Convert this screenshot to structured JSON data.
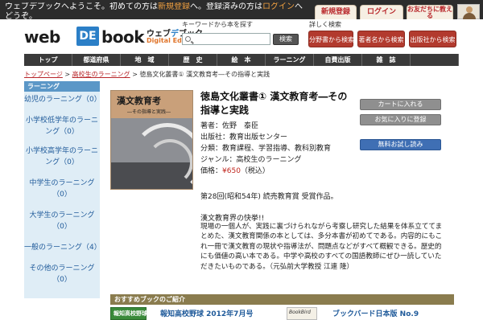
{
  "topbar": {
    "welcome_before": "ウェブデブックへようこそ。初めての方は",
    "welcome_register": "新規登録",
    "welcome_middle": "へ。登録済みの方は",
    "welcome_login": "ログイン",
    "welcome_after": "へどうぞ。",
    "register_label": "新規登録",
    "login_label": "ログイン",
    "cart_label": "お友だちに教える"
  },
  "logo": {
    "web": "web",
    "de": "DE",
    "book": "book",
    "kana_1": "ウェブ",
    "kana_2": "デ",
    "kana_3": "ブック",
    "sub": "Digital Education"
  },
  "search": {
    "label": "キーワードから本を探す",
    "placeholder": "",
    "button": "検索"
  },
  "detail_search": {
    "label": "詳しく検索",
    "by_field": "分野書から検索",
    "by_author": "著者名から検索",
    "by_publisher": "出版社から検索"
  },
  "nav": [
    "トップ",
    "都道府県",
    "地　域",
    "歴　史",
    "絵　本",
    "ラーニング",
    "自費出版",
    "雑　誌",
    ""
  ],
  "breadcrumb": {
    "top": "トップページ",
    "sep": ">",
    "category": "高校生のラーニング",
    "current": "徳島文化叢書① 漢文教育考―その指導と実践"
  },
  "sidebar": {
    "heading": "ラーニング",
    "items": [
      {
        "label": "幼児のラーニング（0）"
      },
      {
        "label": "小学校低学年のラーニング（0）"
      },
      {
        "label": "小学校高学年のラーニング（0）"
      },
      {
        "label": "中学生のラーニング（0）"
      },
      {
        "label": "大学生のラーニング（0）"
      },
      {
        "label": "一般のラーニング（4）"
      },
      {
        "label": "その他のラーニング（0）"
      }
    ]
  },
  "book": {
    "cover_title": "漢文教育考",
    "cover_subtitle": "―その指導と実践―",
    "title": "徳島文化叢書① 漢文教育考―その指導と実践",
    "author": "著者：佐野　泰臣",
    "publisher": "出版社：教育出版センター",
    "field": "分類：教育課程、学習指導、教科別教育",
    "genre": "ジャンル：高校生のラーニング",
    "price_label": "価格：",
    "price_value": "¥650",
    "price_tax": "（税込）",
    "award": "第28回(昭和54年) 読売教育賞 受賞作品。",
    "desc_title": "漢文教育界の快挙!!",
    "desc": "現場の一個人が、実践に裏づけられながら考察し研究した結果を体系立ててまとめた、漢文教育関係の本としては、多分本書が初めてである。内容的にもこれ一冊で漢文教育の現状や指導法が、問題点などがすべて概観できる。歴史的にも価値の高い本である。中学や高校のすべての国語教師にぜひ一読していただきたいものである。（元弘前大学教授 江連 隆）"
  },
  "actions": {
    "add_cart": "カートに入れる",
    "favorite": "お気に入りに登録",
    "trial": "無料お試し読み"
  },
  "recommend": {
    "heading": "おすすめブックのご紹介",
    "item1_thumb": "報知高校野球",
    "item1_title": "報知高校野球 2012年7月号",
    "item2_thumb": "BookBird",
    "item2_title": "ブックバード日本版 No.9"
  }
}
